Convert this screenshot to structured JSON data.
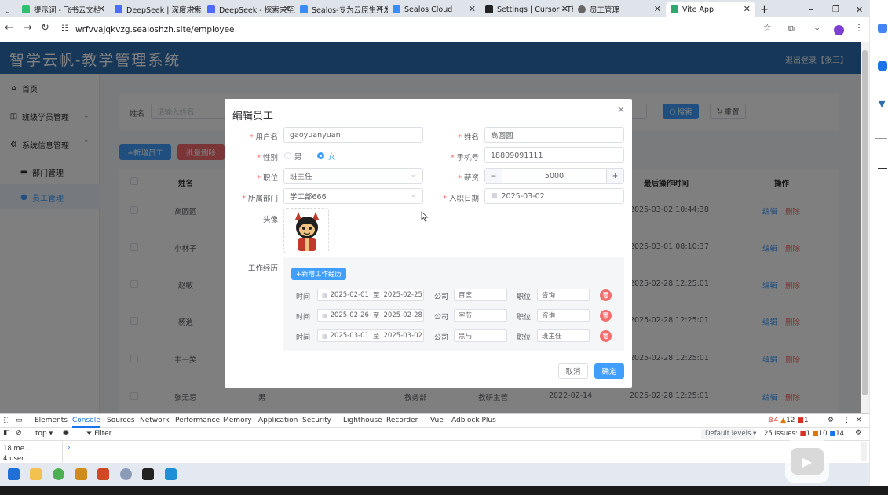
{
  "browser": {
    "tabs": [
      {
        "title": "提示词 - 飞书云文档",
        "fav": "#2fbf71"
      },
      {
        "title": "DeepSeek | 深度求索",
        "fav": "#4d6bfe"
      },
      {
        "title": "DeepSeek - 探索未至之境",
        "fav": "#4d6bfe"
      },
      {
        "title": "Sealos-专为云原生开发",
        "fav": "#3a8bf2"
      },
      {
        "title": "Sealos Cloud",
        "fav": "#3a8bf2"
      },
      {
        "title": "Settings | Cursor - The",
        "fav": "#222222"
      },
      {
        "title": "员工管理",
        "fav": "#666666"
      },
      {
        "title": "Vite App",
        "fav": "#2fa86f"
      }
    ],
    "new_tab": "+",
    "url": "wrfvvajqkvzg.sealoshzh.site/employee"
  },
  "app": {
    "title": "智学云帆-教学管理系统",
    "logout": "退出登录【张三】"
  },
  "sidebar": {
    "home": "首页",
    "class_mgmt": "班级学员管理",
    "sys_mgmt": "系统信息管理",
    "dept_mgmt": "部门管理",
    "emp_mgmt": "员工管理"
  },
  "search": {
    "name_label": "姓名",
    "name_placeholder": "请输入姓名",
    "search_btn": "搜索",
    "reset_btn": "重置"
  },
  "toolbar": {
    "add_btn": "+新增员工",
    "batch_delete_btn": "批量删除"
  },
  "table": {
    "headers": {
      "name": "姓名",
      "updated": "最后操作时间",
      "ops": "操作"
    },
    "rows": [
      {
        "name": "高圆圆",
        "updated": "2025-03-02 10:44:38"
      },
      {
        "name": "小林子",
        "updated": "2025-03-01 08:10:37"
      },
      {
        "name": "赵敏",
        "updated": "2025-02-28 12:25:01"
      },
      {
        "name": "杨逍",
        "updated": "2025-02-28 12:25:01"
      },
      {
        "name": "韦一笑",
        "updated": "2025-02-28 12:25:01"
      },
      {
        "name": "张无忌",
        "gender": "男",
        "dept": "教务部",
        "job": "教研主管",
        "entry": "2022-02-14",
        "updated": "2025-02-28 12:25:01"
      }
    ],
    "edit": "编辑",
    "delete": "删除"
  },
  "dialog": {
    "title": "编辑员工",
    "username_label": "用户名",
    "username": "gaoyuanyuan",
    "name_label": "姓名",
    "name": "高圆圆",
    "gender_label": "性别",
    "gender_male": "男",
    "gender_female": "女",
    "gender_selected": "女",
    "phone_label": "手机号",
    "phone": "18809091111",
    "job_label": "职位",
    "job": "班主任",
    "salary_label": "薪资",
    "salary": "5000",
    "salary_minus": "−",
    "salary_plus": "+",
    "dept_label": "所属部门",
    "dept": "学工部666",
    "entry_label": "入职日期",
    "entry": "2025-03-02",
    "avatar_label": "头像",
    "work_label": "工作经历",
    "add_work_btn": "+新增工作经历",
    "work_time_label": "时间",
    "work_to": "至",
    "work_company_label": "公司",
    "work_job_label": "职位",
    "work": [
      {
        "start": "2025-02-01",
        "end": "2025-02-25",
        "company": "百度",
        "job": "咨询"
      },
      {
        "start": "2025-02-26",
        "end": "2025-02-28",
        "company": "字节",
        "job": "咨询"
      },
      {
        "start": "2025-03-01",
        "end": "2025-03-02",
        "company": "黑马",
        "job": "班主任"
      }
    ],
    "cancel_btn": "取消",
    "ok_btn": "确定"
  },
  "devtools": {
    "tabs": [
      "Elements",
      "Console",
      "Sources",
      "Network",
      "Performance",
      "Memory",
      "Application",
      "Security",
      "Lighthouse",
      "Recorder",
      "Vue",
      "Adblock Plus"
    ],
    "active_tab": "Console",
    "context": "top ▾",
    "filter": "Filter",
    "default_levels": "Default levels ▾",
    "issues": "25 Issues:",
    "issue_counts": [
      "1",
      "10",
      "14"
    ],
    "error_counts": [
      "4",
      "12",
      "1"
    ],
    "side_items": [
      "18 me...",
      "4 user..."
    ]
  },
  "colors": {
    "primary": "#409eff",
    "header": "#2f6eb0",
    "danger": "#f56c6c"
  }
}
